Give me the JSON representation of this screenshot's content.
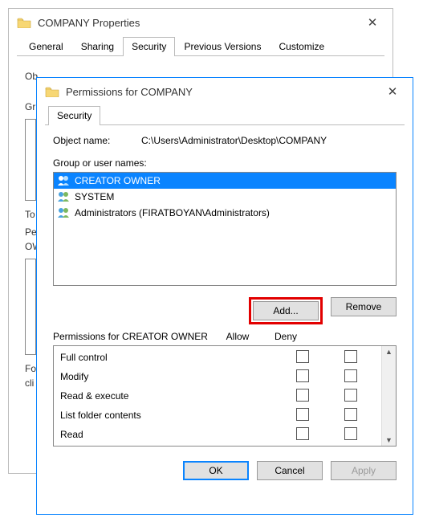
{
  "back": {
    "title": "COMPANY Properties",
    "tabs": [
      "General",
      "Sharing",
      "Security",
      "Previous Versions",
      "Customize"
    ],
    "activeTab": 2,
    "lines": {
      "ob": "Ob",
      "gr": "Gr",
      "to": "To",
      "pe": "Pe",
      "ow": "OW",
      "fo": "Fo",
      "cli": "cli"
    }
  },
  "front": {
    "title": "Permissions for COMPANY",
    "tabs": [
      "Security"
    ],
    "activeTab": 0,
    "objectNameLabel": "Object name:",
    "objectName": "C:\\Users\\Administrator\\Desktop\\COMPANY",
    "groupLabel": "Group or user names:",
    "users": [
      {
        "name": "CREATOR OWNER",
        "selected": true
      },
      {
        "name": "SYSTEM",
        "selected": false
      },
      {
        "name": "Administrators (FIRATBOYAN\\Administrators)",
        "selected": false
      }
    ],
    "addLabel": "Add...",
    "removeLabel": "Remove",
    "permForLabel": "Permissions for CREATOR OWNER",
    "allowLabel": "Allow",
    "denyLabel": "Deny",
    "perms": [
      "Full control",
      "Modify",
      "Read & execute",
      "List folder contents",
      "Read"
    ],
    "ok": "OK",
    "cancel": "Cancel",
    "apply": "Apply"
  }
}
